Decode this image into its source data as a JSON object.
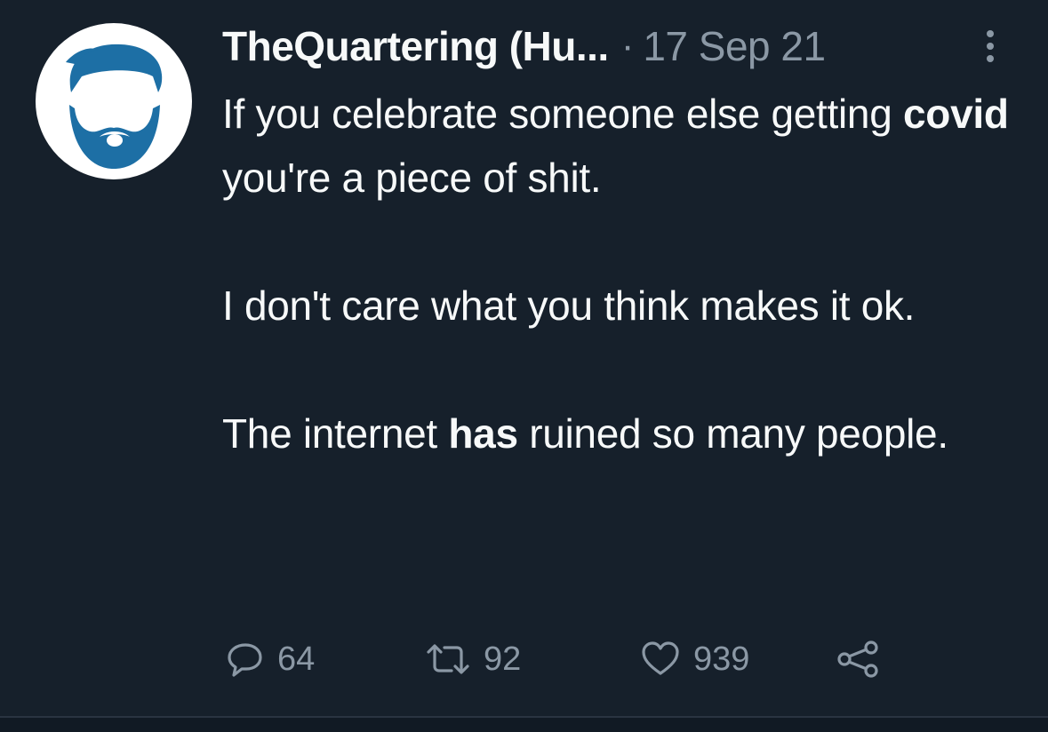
{
  "author": {
    "display_name": "TheQuartering (Hu...",
    "separator": "·",
    "timestamp": "17 Sep 21",
    "avatar_icon": "bearded-man-icon",
    "avatar_color": "#1d6fa5"
  },
  "tweet": {
    "paragraphs": [
      [
        {
          "text": "If you celebrate someone else getting ",
          "bold": false
        },
        {
          "text": "covid",
          "bold": true
        },
        {
          "text": " you're a piece of shit.",
          "bold": false
        }
      ],
      [
        {
          "text": "I don't care what you think makes it ok.",
          "bold": false
        }
      ],
      [
        {
          "text": "The internet ",
          "bold": false
        },
        {
          "text": "has",
          "bold": true
        },
        {
          "text": " ruined so many people.",
          "bold": false
        }
      ]
    ]
  },
  "actions": {
    "reply": {
      "icon": "reply-icon",
      "count": "64"
    },
    "retweet": {
      "icon": "retweet-icon",
      "count": "92"
    },
    "like": {
      "icon": "heart-icon",
      "count": "939"
    },
    "share": {
      "icon": "share-icon"
    }
  },
  "colors": {
    "background": "#16202b",
    "text_primary": "#f7f9f9",
    "text_secondary": "#8b98a5"
  }
}
